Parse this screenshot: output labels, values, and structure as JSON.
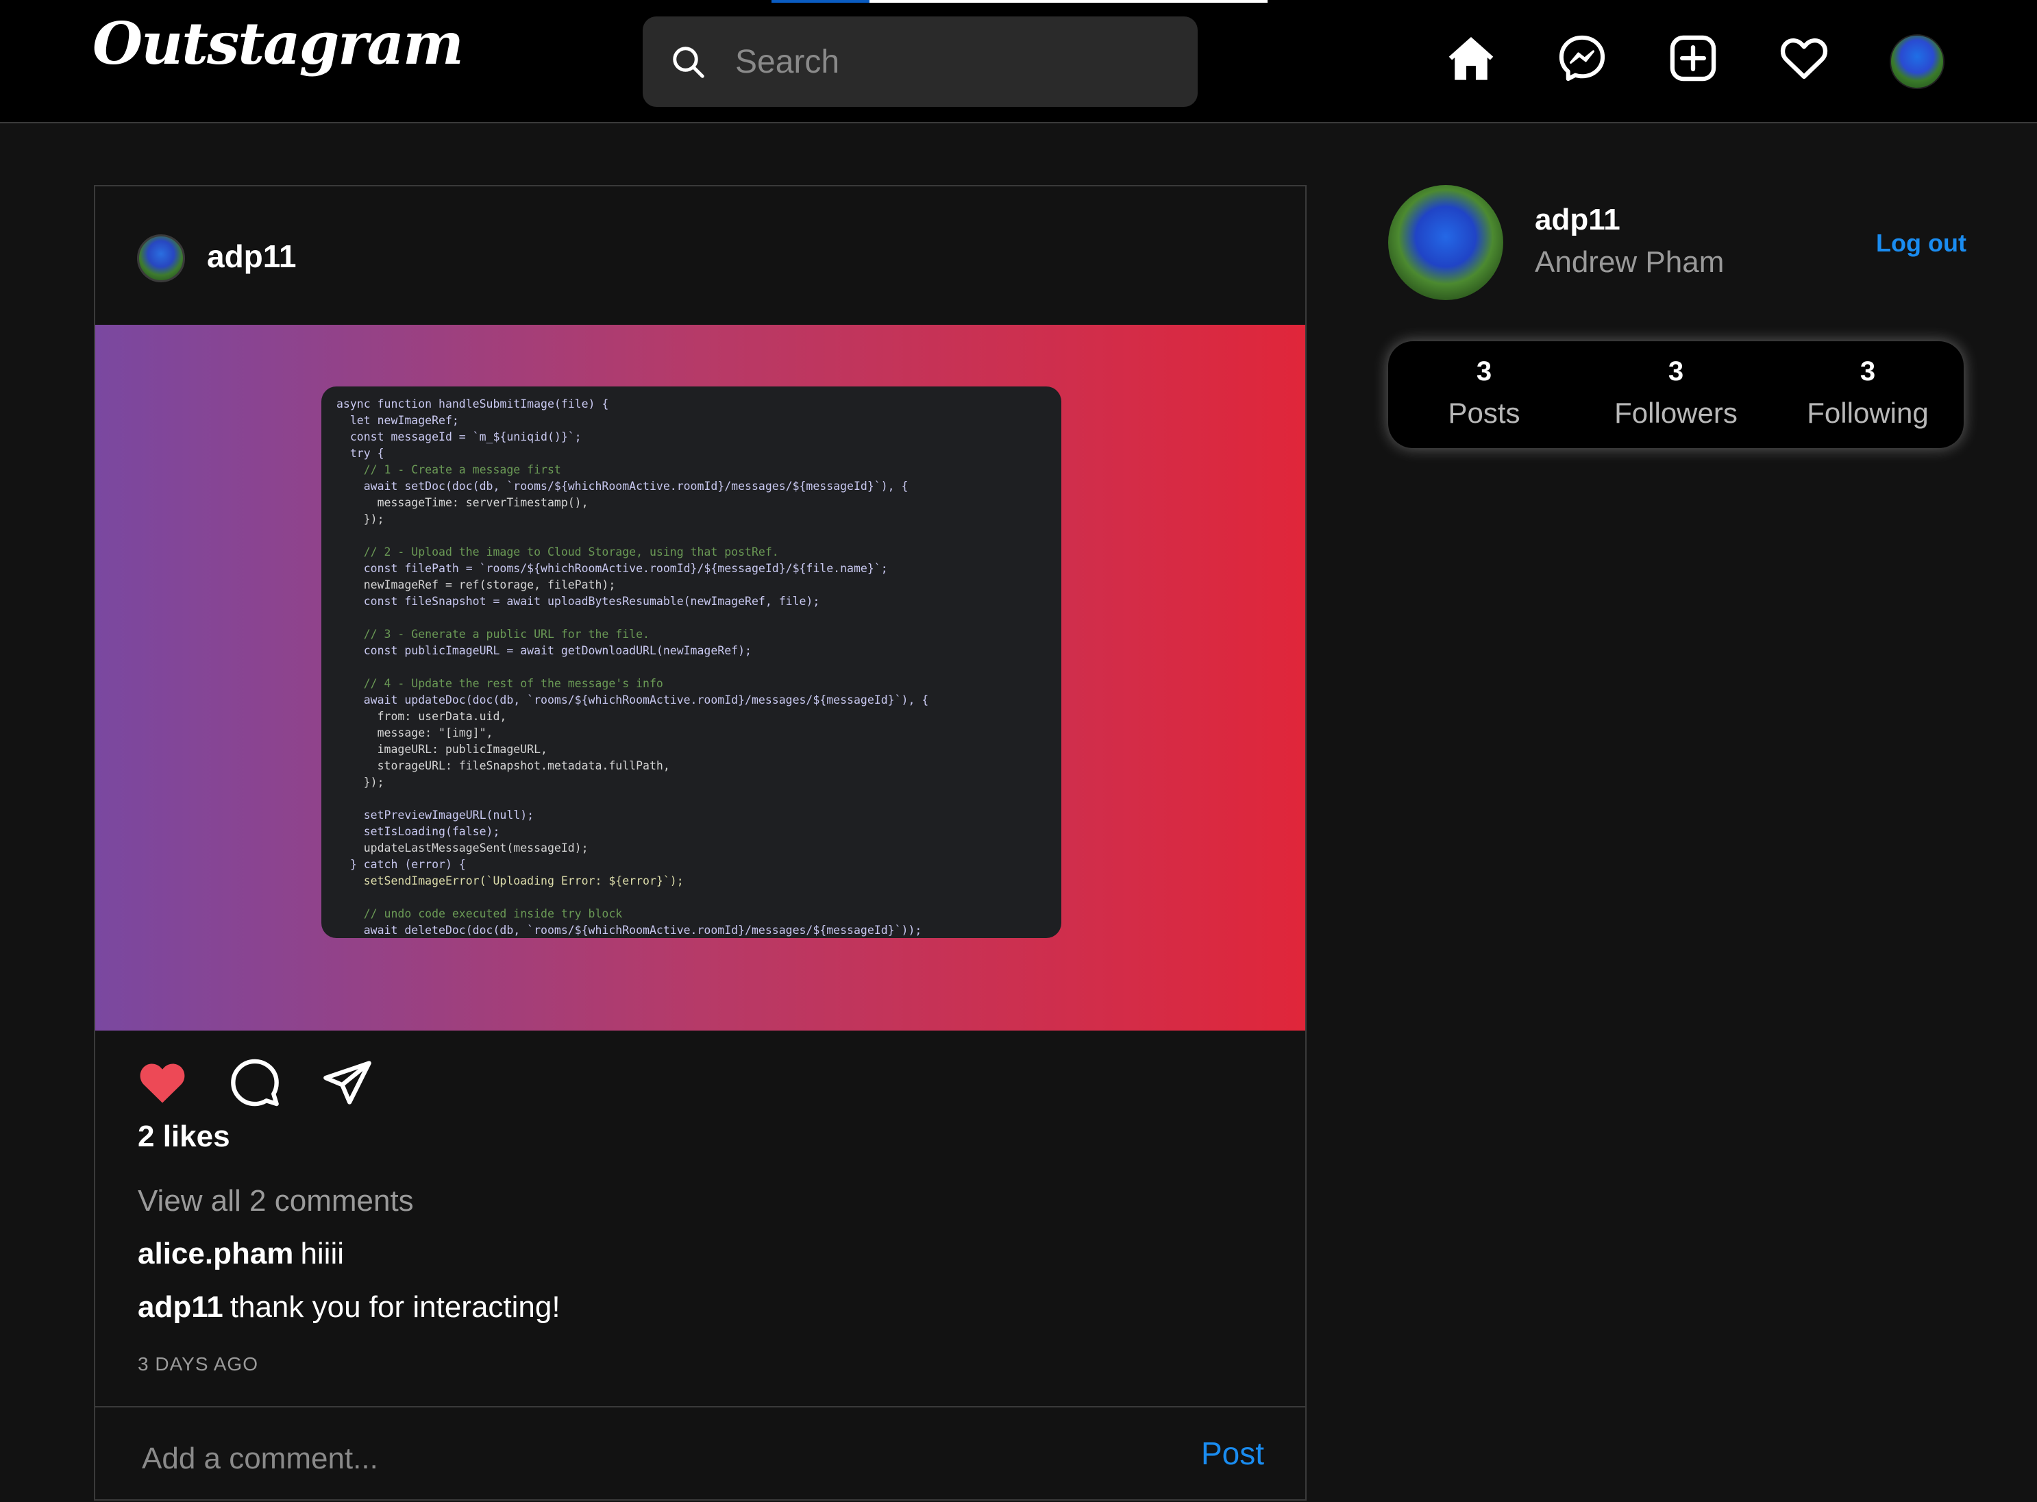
{
  "nav": {
    "logo": "Outstagram",
    "search_placeholder": "Search",
    "icons": [
      "home-icon",
      "messenger-icon",
      "create-icon",
      "heart-icon",
      "profile-avatar"
    ]
  },
  "post": {
    "username": "adp11",
    "likes": "2 likes",
    "view_all": "View all 2 comments",
    "comments": [
      {
        "user": "alice.pham",
        "text": "hiiii"
      },
      {
        "user": "adp11",
        "text": "thank you for interacting!"
      }
    ],
    "time": "3 DAYS AGO",
    "comment_placeholder": "Add a comment...",
    "post_label": "Post",
    "liked": true,
    "code_lines": [
      "async function handleSubmitImage(file) {",
      "  let newImageRef;",
      "  const messageId = `m_${uniqid()}`;",
      "  try {",
      "    // 1 - Create a message first",
      "    await setDoc(doc(db, `rooms/${whichRoomActive.roomId}/messages/${messageId}`), {",
      "      messageTime: serverTimestamp(),",
      "    });",
      "",
      "    // 2 - Upload the image to Cloud Storage, using that postRef.",
      "    const filePath = `rooms/${whichRoomActive.roomId}/${messageId}/${file.name}`;",
      "    newImageRef = ref(storage, filePath);",
      "    const fileSnapshot = await uploadBytesResumable(newImageRef, file);",
      "",
      "    // 3 - Generate a public URL for the file.",
      "    const publicImageURL = await getDownloadURL(newImageRef);",
      "",
      "    // 4 - Update the rest of the message's info",
      "    await updateDoc(doc(db, `rooms/${whichRoomActive.roomId}/messages/${messageId}`), {",
      "      from: userData.uid,",
      "      message: \"[img]\",",
      "      imageURL: publicImageURL,",
      "      storageURL: fileSnapshot.metadata.fullPath,",
      "    });",
      "",
      "    setPreviewImageURL(null);",
      "    setIsLoading(false);",
      "    updateLastMessageSent(messageId);",
      "  } catch (error) {",
      "    setSendImageError(`Uploading Error: ${error}`);",
      "",
      "    // undo code executed inside try block",
      "    await deleteDoc(doc(db, `rooms/${whichRoomActive.roomId}/messages/${messageId}`));"
    ]
  },
  "sidebar": {
    "username": "adp11",
    "full_name": "Andrew Pham",
    "logout": "Log out",
    "stats": [
      {
        "num": "3",
        "label": "Posts"
      },
      {
        "num": "3",
        "label": "Followers"
      },
      {
        "num": "3",
        "label": "Following"
      }
    ]
  },
  "colors": {
    "accent": "#1a8cf0",
    "like": "#ed4956",
    "background": "#121212",
    "topbar": "#000000"
  }
}
